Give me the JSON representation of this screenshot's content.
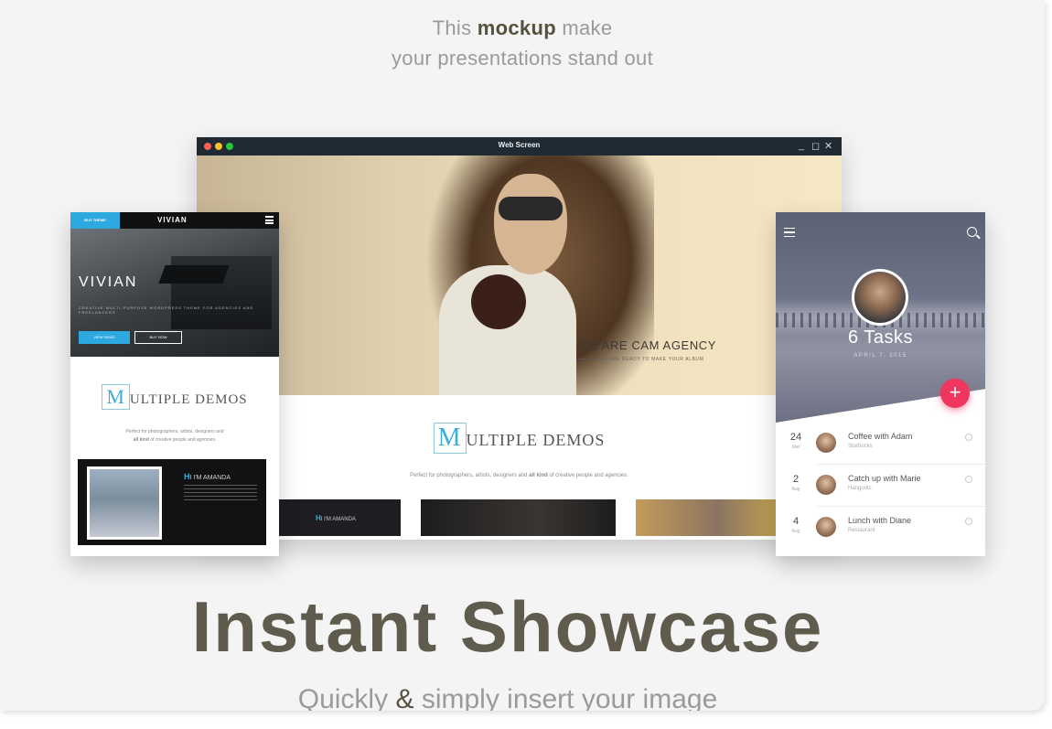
{
  "header": {
    "line1_pre": "This",
    "line1_bold": "mockup",
    "line1_post": "make",
    "line2": "your presentations  stand out"
  },
  "desktop": {
    "window_title": "Web Screen",
    "hero_title": "WE ARE CAM AGENCY",
    "hero_subtitle": "WE ARE READY TO MAKE YOUR ALBUM",
    "multiple_demos_initial": "M",
    "multiple_demos_rest": "ULTIPLE DEMOS",
    "multiple_demos_sub_pre": "Perfect for photographers, artists, designers and",
    "multiple_demos_sub_bold": "all kind",
    "multiple_demos_sub_post": "of creative people and agencies.",
    "thumb_label_initial": "H",
    "thumb_label_rest": "I I'M AMANDA"
  },
  "left_device": {
    "buy_theme": "BUY THEME",
    "logo": "VIVIAN",
    "hero_title": "VIVIAN",
    "hero_tagline": "CREATIVE MULTI-PURPOSE WORDPRESS THEME FOR AGENCIES AND FREELANCERS",
    "btn_view_demo": "VIEW DEMO",
    "btn_buy_now": "BUY NOW",
    "multiple_demos_initial": "M",
    "multiple_demos_rest": "ULTIPLE DEMOS",
    "sub_line1": "Perfect for photographers, artists, designers and",
    "sub_line2_bold": "all kind",
    "sub_line2_post": "of creative people and agencies.",
    "amanda_initial": "H",
    "amanda_rest": "I I'M AMANDA"
  },
  "right_device": {
    "tasks_title": "6 Tasks",
    "tasks_date": "APRIL 7, 2015",
    "fab_label": "+",
    "items": [
      {
        "day": "24",
        "month": "Mar",
        "title": "Coffee with Adam",
        "subtitle": "Starbucks"
      },
      {
        "day": "2",
        "month": "Aug",
        "title": "Catch up with Marie",
        "subtitle": "Hangouts"
      },
      {
        "day": "4",
        "month": "Aug",
        "title": "Lunch with Diane",
        "subtitle": "Restaurant"
      }
    ]
  },
  "footer": {
    "title": "Instant Showcase",
    "sub_pre": "Quickly",
    "sub_amp": "&",
    "sub_post": "simply insert your image"
  },
  "colors": {
    "accent_blue": "#2ea9df",
    "fab_pink": "#f0365e",
    "title_olive": "#5f5b4d"
  }
}
